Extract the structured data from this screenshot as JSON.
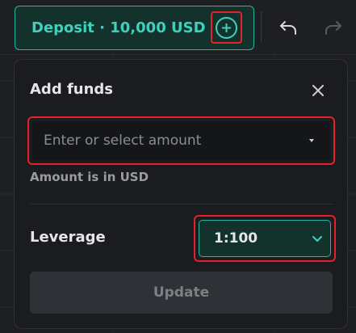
{
  "toolbar": {
    "deposit_label": "Deposit · 10,000 USD",
    "icons": [
      "add-funds-plus-icon",
      "undo-icon",
      "redo-icon"
    ]
  },
  "popover": {
    "title": "Add funds",
    "amount_placeholder": "Enter or select amount",
    "amount_hint": "Amount is in USD",
    "leverage_label": "Leverage",
    "leverage_value": "1:100",
    "update_label": "Update"
  },
  "colors": {
    "accent": "#3fd1bd",
    "highlight": "#e5212b",
    "panel": "#1b1c1f"
  }
}
